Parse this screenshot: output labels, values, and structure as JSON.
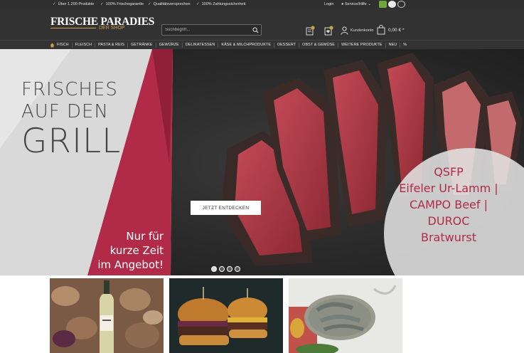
{
  "topbar": {
    "usps": [
      {
        "text": "Über 1.200 Produkte"
      },
      {
        "text": "100% Frischegarantie"
      },
      {
        "text": "Qualitätsversprechen"
      },
      {
        "text": "100% Zahlungssicherheit"
      }
    ],
    "login": "Login",
    "service": "Service/Hilfe"
  },
  "header": {
    "logo_main": "FRISCHE PARADIES",
    "logo_sub": "DER SHOP",
    "search_placeholder": "Suchbegriff...",
    "account_label": "Kundenkonto",
    "cart_total": "0,00 € *"
  },
  "nav": {
    "items": [
      "FISCH",
      "FLEISCH",
      "PASTA & REIS",
      "GETRÄNKE",
      "GEWÜRZE",
      "DELIKATESSEN",
      "KÄSE & MILCHPRODUKTE",
      "DESSERT",
      "OBST & GEMÜSE",
      "WEITERE PRODUKTE",
      "NEU",
      "%"
    ]
  },
  "hero": {
    "title_line1": "FRISCHES",
    "title_line2": "AUF DEN",
    "title_line3": "GRILL",
    "promo_line1": "Nur für",
    "promo_line2": "kurze Zeit",
    "promo_line3": "im Angebot!",
    "cta_label": "JETZT ENTDECKEN",
    "circle_lines": [
      "QSFP",
      "Eifeler Ur-Lamm |",
      "CAMPO Beef |",
      "DUROC",
      "Bratwurst"
    ],
    "slide_count": 4,
    "active_slide": 1
  },
  "colors": {
    "accent_red": "#b12a47",
    "gold": "#c9a24a",
    "header_bg": "#323232"
  }
}
